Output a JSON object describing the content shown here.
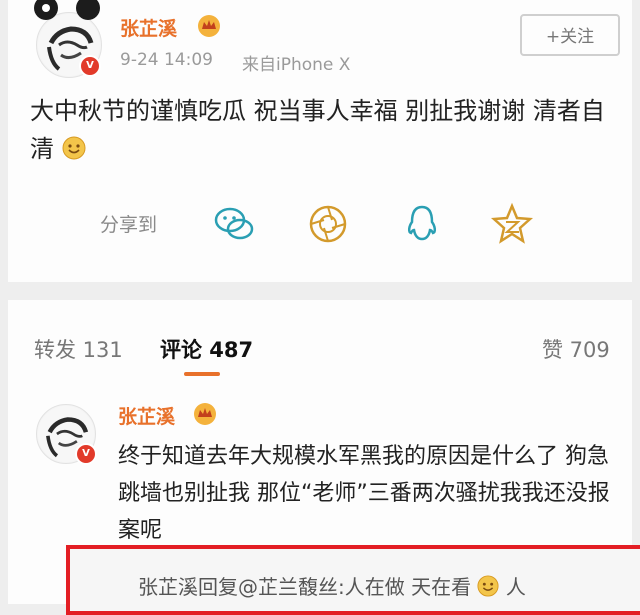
{
  "post": {
    "author": "张芷溪",
    "time": "9-24 14:09",
    "source": "来自iPhone X",
    "follow_label": "+关注",
    "text": "大中秋节的谨慎吃瓜 祝当事人幸福 别扯我谢谢 清者自清",
    "share_label": "分享到",
    "share_icons": [
      "wechat-icon",
      "moments-icon",
      "qq-icon",
      "qzone-icon"
    ]
  },
  "tabs": {
    "repost": "转发 131",
    "comments": "评论 487",
    "likes": "赞 709"
  },
  "comment": {
    "author": "张芷溪",
    "text": "终于知道去年大规模水军黑我的原因是什么了 狗急跳墙也别扯我 那位“老师”三番两次骚扰我我还没报案呢"
  },
  "reply": {
    "prefix": "张芷溪回复@芷兰馥丝:",
    "text": "人在做 天在看",
    "suffix": "人"
  },
  "colors": {
    "username": "#e8712b",
    "highlight_box": "#e31e24",
    "verified": "#e23a2a"
  }
}
